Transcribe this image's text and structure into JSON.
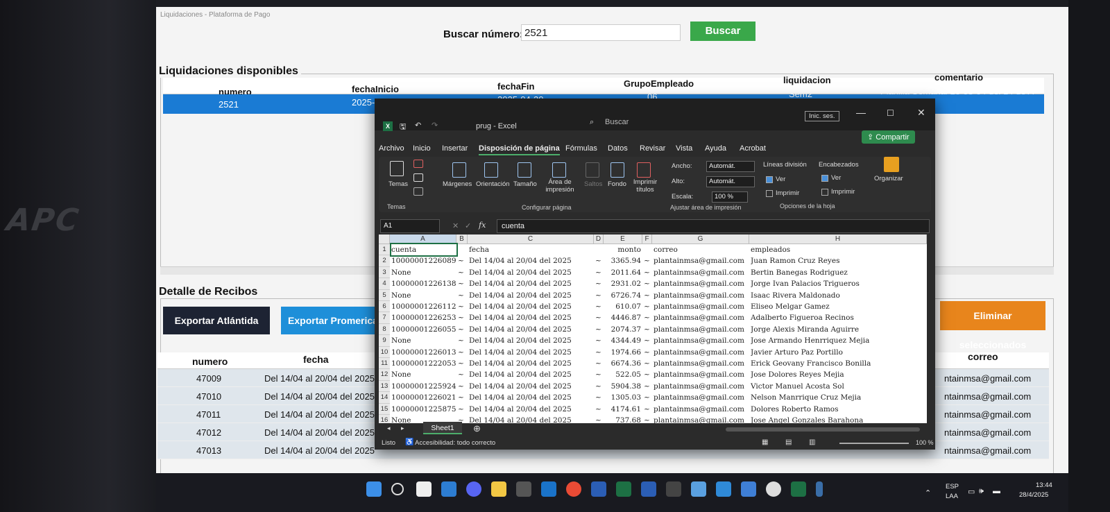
{
  "app": {
    "window_title": "Liquidaciones - Plataforma de Pago",
    "search_label": "Buscar número:",
    "search_value": "2521",
    "search_button": "Buscar"
  },
  "liquidaciones": {
    "section_title": "Liquidaciones disponibles",
    "headers": [
      "numero",
      "fechaInicio",
      "fechaFin",
      "GrupoEmpleado",
      "liquidacion",
      "comentario"
    ],
    "row": [
      "2521",
      "2025-04-14",
      "2025-04-20",
      "06",
      "Sem2",
      "Planilla Semanal 16-03-04 del 14 de A"
    ]
  },
  "detalle": {
    "section_title": "Detalle de Recibos",
    "export_atlantida": "Exportar Atlántida",
    "export_promerica": "Exportar Promerica",
    "delete_selected": "Eliminar seleccionados",
    "headers": [
      "numero",
      "fecha",
      "correo"
    ],
    "rows": [
      [
        "47009",
        "Del 14/04 al 20/04 del 2025",
        "ntainmsa@gmail.com"
      ],
      [
        "47010",
        "Del 14/04 al 20/04 del 2025",
        "ntainmsa@gmail.com"
      ],
      [
        "47011",
        "Del 14/04 al 20/04 del 2025",
        "ntainmsa@gmail.com"
      ],
      [
        "47012",
        "Del 14/04 al 20/04 del 2025",
        "ntainmsa@gmail.com"
      ],
      [
        "47013",
        "Del 14/04 al 20/04 del 2025",
        "ntainmsa@gmail.com"
      ]
    ]
  },
  "excel": {
    "filename": "prug - Excel",
    "search": "Buscar",
    "sign_in": "Inic. ses.",
    "share": "Compartir",
    "tabs": [
      "Archivo",
      "Inicio",
      "Insertar",
      "Disposición de página",
      "Fórmulas",
      "Datos",
      "Revisar",
      "Vista",
      "Ayuda",
      "Acrobat"
    ],
    "ribbon": {
      "temas": "Temas",
      "temas_group": "Temas",
      "margenes": "Márgenes",
      "orientacion": "Orientación",
      "tamano": "Tamaño",
      "area": "Área de impresión",
      "saltos": "Saltos",
      "fondo": "Fondo",
      "imprimir_titulos": "Imprimir títulos",
      "config_group": "Configurar página",
      "ancho_label": "Ancho:",
      "ancho_value": "Automát.",
      "alto_label": "Alto:",
      "alto_value": "Automát.",
      "escala_label": "Escala:",
      "escala_value": "100 %",
      "ajustar_group": "Ajustar área de impresión",
      "lineas": "Líneas división",
      "encabezados": "Encabezados",
      "ver": "Ver",
      "imprimir": "Imprimir",
      "opciones_group": "Opciones de la hoja",
      "organizar": "Organizar"
    },
    "name_box": "A1",
    "formula": "cuenta",
    "columns": [
      "A",
      "B",
      "C",
      "D",
      "E",
      "F",
      "G",
      "H"
    ],
    "rows": [
      [
        "cuenta",
        "",
        "fecha",
        "",
        "monto",
        "",
        "correo",
        "empleados"
      ],
      [
        "10000001226089",
        "~",
        "Del 14/04 al 20/04 del 2025",
        "~",
        "3365.94",
        "~",
        "plantainmsa@gmail.com",
        "Juan Ramon Cruz Reyes"
      ],
      [
        "None",
        "~",
        "Del 14/04 al 20/04 del 2025",
        "~",
        "2011.64",
        "~",
        "plantainmsa@gmail.com",
        "Bertin Banegas Rodriguez"
      ],
      [
        "10000001226138",
        "~",
        "Del 14/04 al 20/04 del 2025",
        "~",
        "2931.02",
        "~",
        "plantainmsa@gmail.com",
        "Jorge Ivan Palacios Trigueros"
      ],
      [
        "None",
        "~",
        "Del 14/04 al 20/04 del 2025",
        "~",
        "6726.74",
        "~",
        "plantainmsa@gmail.com",
        "Isaac Rivera Maldonado"
      ],
      [
        "10000001226112",
        "~",
        "Del 14/04 al 20/04 del 2025",
        "~",
        "610.07",
        "~",
        "plantainmsa@gmail.com",
        "Eliseo Melgar Gamez"
      ],
      [
        "10000001226253",
        "~",
        "Del 14/04 al 20/04 del 2025",
        "~",
        "4446.87",
        "~",
        "plantainmsa@gmail.com",
        "Adalberto Figueroa Recinos"
      ],
      [
        "10000001226055",
        "~",
        "Del 14/04 al 20/04 del 2025",
        "~",
        "2074.37",
        "~",
        "plantainmsa@gmail.com",
        "Jorge Alexis Miranda Aguirre"
      ],
      [
        "None",
        "~",
        "Del 14/04 al 20/04 del 2025",
        "~",
        "4344.49",
        "~",
        "plantainmsa@gmail.com",
        "Jose Armando Henrriquez Mejia"
      ],
      [
        "10000001226013",
        "~",
        "Del 14/04 al 20/04 del 2025",
        "~",
        "1974.66",
        "~",
        "plantainmsa@gmail.com",
        "Javier Arturo Paz Portillo"
      ],
      [
        "10000001222053",
        "~",
        "Del 14/04 al 20/04 del 2025",
        "~",
        "6674.36",
        "~",
        "plantainmsa@gmail.com",
        "Erick Geovany Francisco Bonilla"
      ],
      [
        "None",
        "~",
        "Del 14/04 al 20/04 del 2025",
        "~",
        "522.05",
        "~",
        "plantainmsa@gmail.com",
        "Jose Dolores Reyes Mejia"
      ],
      [
        "10000001225924",
        "~",
        "Del 14/04 al 20/04 del 2025",
        "~",
        "5904.38",
        "~",
        "plantainmsa@gmail.com",
        "Victor Manuel Acosta Sol"
      ],
      [
        "10000001226021",
        "~",
        "Del 14/04 al 20/04 del 2025",
        "~",
        "1305.03",
        "~",
        "plantainmsa@gmail.com",
        "Nelson Manrrique Cruz Mejia"
      ],
      [
        "10000001225875",
        "~",
        "Del 14/04 al 20/04 del 2025",
        "~",
        "4174.61",
        "~",
        "plantainmsa@gmail.com",
        "Dolores Roberto  Ramos"
      ],
      [
        "None",
        "~",
        "Del 14/04 al 20/04 del 2025",
        "~",
        "737.68",
        "~",
        "plantainmsa@gmail.com",
        "Jose Angel Gonzales Barahona"
      ]
    ],
    "sheet_tab": "Sheet1",
    "status_ready": "Listo",
    "status_accessibility": "Accesibilidad: todo correcto",
    "zoom": "100 %"
  },
  "taskbar": {
    "lang": "ESP",
    "region": "LAA",
    "time": "13:44",
    "date": "28/4/2025"
  },
  "bezel": {
    "brand": "APC"
  }
}
